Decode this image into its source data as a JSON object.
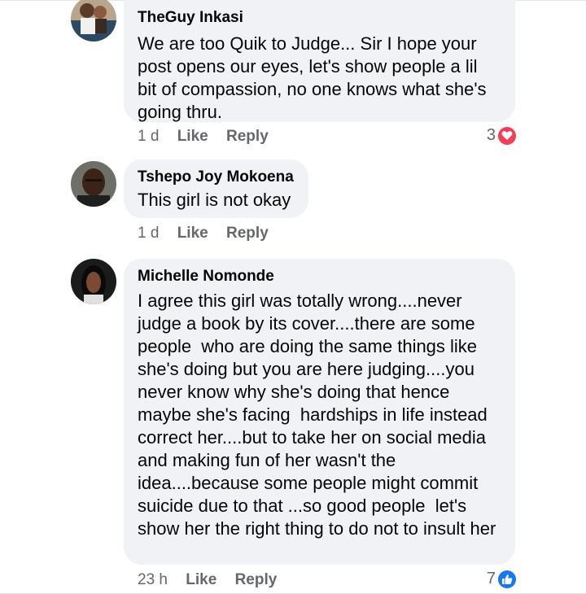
{
  "colors": {
    "bubble": "#f0f2f5",
    "love": "#f33e58",
    "like": "#1877f2",
    "meta_text": "#65676b"
  },
  "comments": [
    {
      "author": "TheGuy Inkasi",
      "text": "We are too Quik to Judge... Sir I hope your post opens our eyes, let's show people a lil bit of compassion, no one knows what she's going thru.",
      "time": "1 d",
      "like_label": "Like",
      "reply_label": "Reply",
      "reaction_count": "3",
      "reaction_icon": "heart-icon"
    },
    {
      "author": "Tshepo Joy Mokoena",
      "text": "This girl is not okay",
      "time": "1 d",
      "like_label": "Like",
      "reply_label": "Reply"
    },
    {
      "author": "Michelle Nomonde",
      "text": "I agree this girl was totally wrong....never judge a book by its cover....there are some people  who are doing the same things like she's doing but you are here judging....you never know why she's doing that hence maybe she's facing  hardships in life instead correct her....but to take her on social media and making fun of her wasn't the idea....because some people might commit suicide due to that ...so good people  let's show her the right thing to do not to insult her",
      "time": "23 h",
      "like_label": "Like",
      "reply_label": "Reply",
      "reaction_count": "7",
      "reaction_icon": "thumbs-up-icon"
    }
  ]
}
